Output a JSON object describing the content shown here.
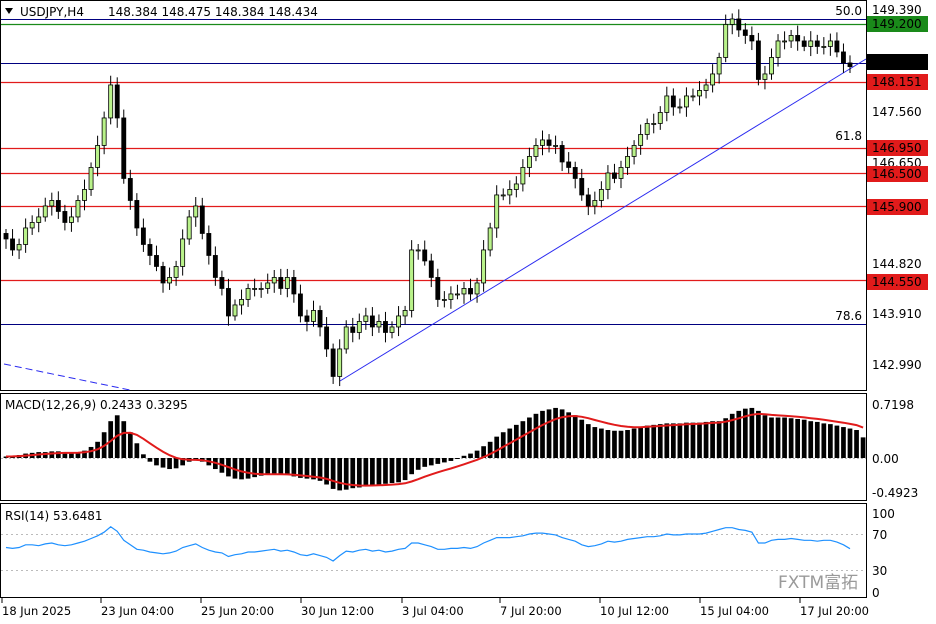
{
  "header": {
    "symbol": "USDJPY,H4",
    "ohlc": "148.384 148.475 148.384 148.434"
  },
  "price_axis": {
    "ticks": [
      "149.390",
      "147.560",
      "146.650",
      "144.820",
      "143.910",
      "142.990"
    ],
    "current_price": "148.434",
    "levels": [
      {
        "label": "149.200",
        "color": "#1a8a1a",
        "value": 149.2
      },
      {
        "label": "148.151",
        "color": "#e11b1b",
        "value": 148.151
      },
      {
        "label": "146.950",
        "color": "#e11b1b",
        "value": 146.95
      },
      {
        "label": "146.500",
        "color": "#e11b1b",
        "value": 146.5
      },
      {
        "label": "145.900",
        "color": "#e11b1b",
        "value": 145.9
      },
      {
        "label": "144.550",
        "color": "#e11b1b",
        "value": 144.55
      }
    ],
    "fib_labels": [
      {
        "label": "50.0",
        "value": 149.39
      },
      {
        "label": "61.8",
        "value": 147.1
      },
      {
        "label": "78.6",
        "value": 143.85
      }
    ]
  },
  "macd": {
    "title": "MACD(12,26,9) 0.2433 0.3295",
    "ticks": [
      "0.7198",
      "0.00",
      "-0.4923"
    ]
  },
  "rsi": {
    "title": "RSI(14) 53.6481",
    "ticks": [
      "100",
      "70",
      "30",
      "0"
    ]
  },
  "time_axis": {
    "labels": [
      "18 Jun 2025",
      "23 Jun 04:00",
      "25 Jun 20:00",
      "30 Jun 12:00",
      "3 Jul 04:00",
      "7 Jul 20:00",
      "10 Jul 12:00",
      "15 Jul 04:00",
      "17 Jul 20:00"
    ]
  },
  "watermark": "FXTM富拓",
  "chart_data": {
    "type": "candlestick",
    "symbol": "USDJPY",
    "timeframe": "H4",
    "ylim": [
      142.45,
      149.65
    ],
    "closes": [
      145.3,
      145.1,
      145.2,
      145.5,
      145.6,
      145.7,
      145.9,
      146.0,
      145.8,
      145.6,
      145.7,
      146.0,
      146.2,
      146.6,
      147.0,
      147.5,
      148.1,
      147.5,
      146.4,
      146.0,
      145.5,
      145.2,
      145.0,
      144.8,
      144.5,
      144.6,
      144.8,
      145.3,
      145.7,
      145.9,
      145.4,
      145.0,
      144.6,
      144.4,
      143.9,
      144.1,
      144.2,
      144.4,
      144.4,
      144.4,
      144.5,
      144.6,
      144.4,
      144.6,
      144.3,
      143.9,
      143.8,
      144.0,
      143.7,
      143.3,
      142.8,
      143.3,
      143.7,
      143.6,
      143.8,
      143.9,
      143.7,
      143.8,
      143.6,
      143.7,
      143.9,
      144.0,
      145.1,
      145.1,
      144.9,
      144.6,
      144.2,
      144.2,
      144.3,
      144.3,
      144.4,
      144.3,
      144.5,
      145.1,
      145.5,
      146.1,
      146.1,
      146.2,
      146.3,
      146.6,
      146.8,
      147.0,
      147.1,
      147.0,
      147.0,
      146.7,
      146.6,
      146.4,
      146.1,
      145.9,
      146.0,
      146.2,
      146.5,
      146.4,
      146.6,
      146.8,
      147.0,
      147.2,
      147.4,
      147.4,
      147.6,
      147.9,
      147.7,
      147.7,
      147.9,
      147.9,
      148.0,
      148.1,
      148.3,
      148.6,
      149.2,
      149.3,
      149.1,
      149.0,
      148.9,
      148.2,
      148.3,
      148.6,
      148.9,
      148.9,
      149.0,
      148.9,
      148.8,
      148.9,
      148.8,
      148.8,
      148.9,
      148.7,
      148.5,
      148.434
    ],
    "horizontal_levels": [
      149.2,
      148.151,
      146.95,
      146.5,
      145.9,
      144.55
    ],
    "current_price": 148.434,
    "macd_histogram": [
      0.02,
      0.03,
      0.04,
      0.06,
      0.07,
      0.08,
      0.08,
      0.09,
      0.09,
      0.08,
      0.07,
      0.08,
      0.1,
      0.15,
      0.22,
      0.35,
      0.5,
      0.58,
      0.5,
      0.35,
      0.2,
      0.05,
      -0.05,
      -0.1,
      -0.13,
      -0.15,
      -0.14,
      -0.1,
      -0.05,
      -0.03,
      -0.05,
      -0.1,
      -0.15,
      -0.2,
      -0.25,
      -0.28,
      -0.29,
      -0.28,
      -0.26,
      -0.24,
      -0.23,
      -0.22,
      -0.22,
      -0.23,
      -0.25,
      -0.27,
      -0.28,
      -0.29,
      -0.31,
      -0.36,
      -0.42,
      -0.44,
      -0.43,
      -0.41,
      -0.4,
      -0.38,
      -0.37,
      -0.36,
      -0.35,
      -0.34,
      -0.33,
      -0.3,
      -0.22,
      -0.16,
      -0.12,
      -0.1,
      -0.08,
      -0.06,
      -0.04,
      0.0,
      0.03,
      0.06,
      0.1,
      0.16,
      0.22,
      0.29,
      0.35,
      0.4,
      0.45,
      0.5,
      0.55,
      0.6,
      0.64,
      0.66,
      0.68,
      0.66,
      0.62,
      0.58,
      0.52,
      0.46,
      0.42,
      0.4,
      0.38,
      0.37,
      0.37,
      0.38,
      0.4,
      0.42,
      0.44,
      0.45,
      0.46,
      0.47,
      0.47,
      0.47,
      0.48,
      0.48,
      0.48,
      0.49,
      0.5,
      0.5,
      0.54,
      0.6,
      0.64,
      0.67,
      0.68,
      0.64,
      0.58,
      0.55,
      0.55,
      0.55,
      0.54,
      0.53,
      0.52,
      0.5,
      0.49,
      0.47,
      0.46,
      0.44,
      0.42,
      0.4,
      0.38,
      0.28
    ],
    "rsi": [
      55,
      54,
      55,
      58,
      58,
      57,
      59,
      60,
      58,
      57,
      58,
      60,
      62,
      65,
      68,
      72,
      78,
      73,
      63,
      58,
      53,
      52,
      50,
      49,
      48,
      49,
      51,
      55,
      57,
      59,
      55,
      52,
      50,
      49,
      45,
      47,
      48,
      50,
      50,
      51,
      52,
      53,
      51,
      52,
      50,
      47,
      46,
      48,
      46,
      44,
      40,
      46,
      51,
      50,
      52,
      53,
      51,
      52,
      50,
      51,
      53,
      54,
      60,
      60,
      58,
      56,
      53,
      53,
      54,
      54,
      55,
      54,
      56,
      60,
      63,
      66,
      66,
      66,
      67,
      68,
      70,
      71,
      71,
      70,
      69,
      66,
      64,
      62,
      58,
      56,
      57,
      59,
      62,
      61,
      62,
      64,
      65,
      66,
      67,
      67,
      68,
      70,
      69,
      69,
      70,
      70,
      70,
      71,
      73,
      75,
      77,
      77,
      75,
      74,
      72,
      60,
      60,
      63,
      64,
      64,
      65,
      64,
      63,
      63,
      62,
      63,
      63,
      61,
      58,
      53.6481
    ],
    "rsi_levels": [
      70,
      30
    ]
  }
}
